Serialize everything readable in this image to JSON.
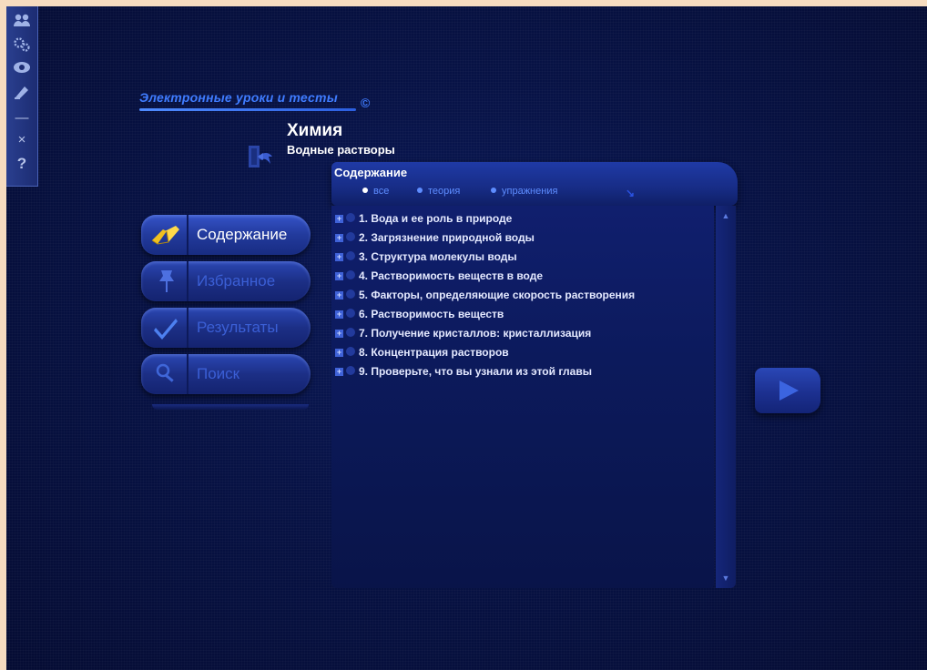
{
  "toolbar": {
    "buttons": [
      {
        "name": "users-icon"
      },
      {
        "name": "settings-icon"
      },
      {
        "name": "view-icon"
      },
      {
        "name": "edit-icon"
      },
      {
        "name": "minimize-icon",
        "glyph": "—"
      },
      {
        "name": "close-icon",
        "glyph": "×"
      },
      {
        "name": "help-icon",
        "glyph": "?"
      }
    ]
  },
  "header": {
    "brand": "Электронные уроки и тесты",
    "copyright": "©",
    "subject": "Химия",
    "topic": "Водные растворы"
  },
  "nav": {
    "items": [
      {
        "label": "Содержание",
        "icon": "book-icon",
        "active": true
      },
      {
        "label": "Избранное",
        "icon": "pushpin-icon",
        "active": false
      },
      {
        "label": "Результаты",
        "icon": "checkmark-icon",
        "active": false
      },
      {
        "label": "Поиск",
        "icon": "magnifier-icon",
        "active": false
      }
    ]
  },
  "panel": {
    "heading": "Содержание",
    "filters": [
      {
        "label": "все",
        "active": true
      },
      {
        "label": "теория",
        "active": false
      },
      {
        "label": "упражнения",
        "active": false
      }
    ],
    "items": [
      "1. Вода и ее роль в природе",
      "2. Загрязнение природной воды",
      "3. Структура молекулы воды",
      "4. Растворимость веществ в воде",
      "5. Факторы, определяющие скорость растворения",
      "6. Растворимость веществ",
      "7. Получение кристаллов: кристаллизация",
      "8. Концентрация растворов",
      "9. Проверьте, что вы узнали из этой главы"
    ]
  },
  "colors": {
    "background": "#071245",
    "accent": "#3f7cff",
    "text": "#ffffff",
    "inactive_label": "#3b5fd6"
  }
}
